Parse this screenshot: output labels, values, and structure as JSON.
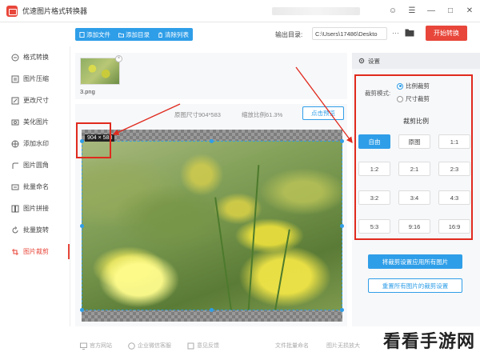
{
  "app": {
    "title": "优速图片格式转换器",
    "window_controls": [
      "☺",
      "☰",
      "—",
      "□",
      "✕"
    ]
  },
  "toolbar": {
    "add_file": "添加文件",
    "add_dir": "添加目录",
    "clear_list": "清除列表",
    "output_label": "输出目录:",
    "output_path": "C:\\Users\\17486\\Deskto",
    "more": "···",
    "start": "开始转换"
  },
  "sidebar": {
    "items": [
      {
        "label": "格式转换",
        "icon": "format-icon"
      },
      {
        "label": "图片压缩",
        "icon": "compress-icon"
      },
      {
        "label": "更改尺寸",
        "icon": "resize-icon"
      },
      {
        "label": "美化图片",
        "icon": "beautify-icon"
      },
      {
        "label": "添加水印",
        "icon": "watermark-icon"
      },
      {
        "label": "图片圆角",
        "icon": "round-corner-icon"
      },
      {
        "label": "批量命名",
        "icon": "rename-icon"
      },
      {
        "label": "图片拼接",
        "icon": "splice-icon"
      },
      {
        "label": "批量旋转",
        "icon": "rotate-icon"
      },
      {
        "label": "图片裁剪",
        "icon": "crop-icon",
        "active": true
      }
    ]
  },
  "files": [
    {
      "name": "3.png"
    }
  ],
  "preview": {
    "original_size": "原图尺寸904*583",
    "scale": "缩放比例61.3%",
    "preview_button": "点击预览",
    "dimension_badge": "904 × 583"
  },
  "settings": {
    "header": "设置",
    "mode_label": "裁剪模式:",
    "modes": [
      {
        "label": "比例裁剪",
        "selected": true
      },
      {
        "label": "尺寸裁剪",
        "selected": false
      }
    ],
    "ratio_title": "裁剪比例",
    "ratios": [
      {
        "label": "自由",
        "selected": true
      },
      {
        "label": "原图",
        "selected": false
      },
      {
        "label": "1:1",
        "selected": false
      },
      {
        "label": "1:2",
        "selected": false
      },
      {
        "label": "2:1",
        "selected": false
      },
      {
        "label": "2:3",
        "selected": false
      },
      {
        "label": "3:2",
        "selected": false
      },
      {
        "label": "3:4",
        "selected": false
      },
      {
        "label": "4:3",
        "selected": false
      },
      {
        "label": "5:3",
        "selected": false
      },
      {
        "label": "9:16",
        "selected": false
      },
      {
        "label": "16:9",
        "selected": false
      }
    ],
    "apply_all": "将裁剪设置应用所有图片",
    "reset_all": "重置所有图片的裁剪设置"
  },
  "footer": {
    "items": [
      "官方网站",
      "企业微信客服",
      "意见反馈",
      "文件批量命名",
      "图片无损放大"
    ]
  },
  "watermark": "看看手游网",
  "colors": {
    "accent": "#2f9ee8",
    "brand_red": "#e8463a",
    "annotation_red": "#e02a1e"
  }
}
